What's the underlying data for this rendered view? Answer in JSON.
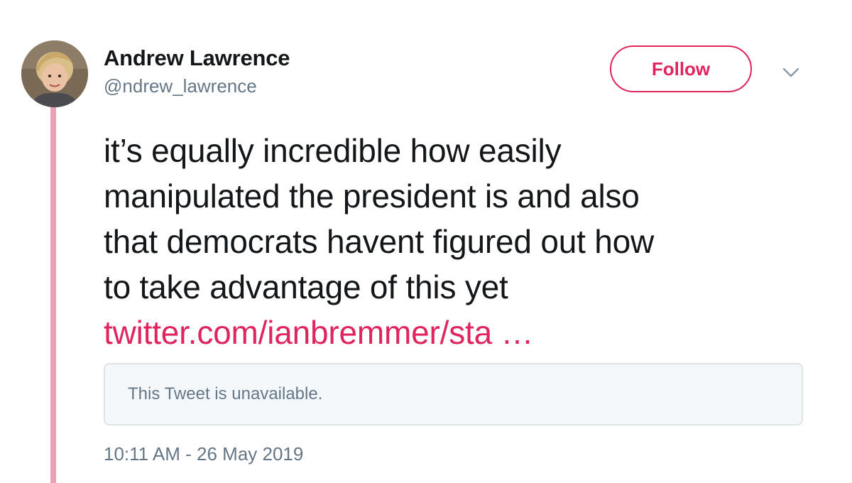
{
  "author": {
    "name": "Andrew Lawrence",
    "handle": "@ndrew_lawrence"
  },
  "actions": {
    "follow_label": "Follow"
  },
  "tweet": {
    "lines": [
      "it’s equally incredible how easily",
      "manipulated the president is and also",
      "that democrats havent figured out how",
      "to take advantage of this yet"
    ],
    "link_text": "twitter.com/ianbremmer/sta …"
  },
  "quoted_tweet": {
    "text": "This Tweet is unavailable."
  },
  "timestamp": "10:11 AM - 26 May 2019",
  "colors": {
    "accent": "#e0245e",
    "thread_line": "#e8a2b5",
    "secondary_text": "#657786",
    "quoted_border": "#dde3e8",
    "quoted_bg": "#f5f8fa"
  },
  "icons": {
    "menu": "chevron-down-icon"
  }
}
